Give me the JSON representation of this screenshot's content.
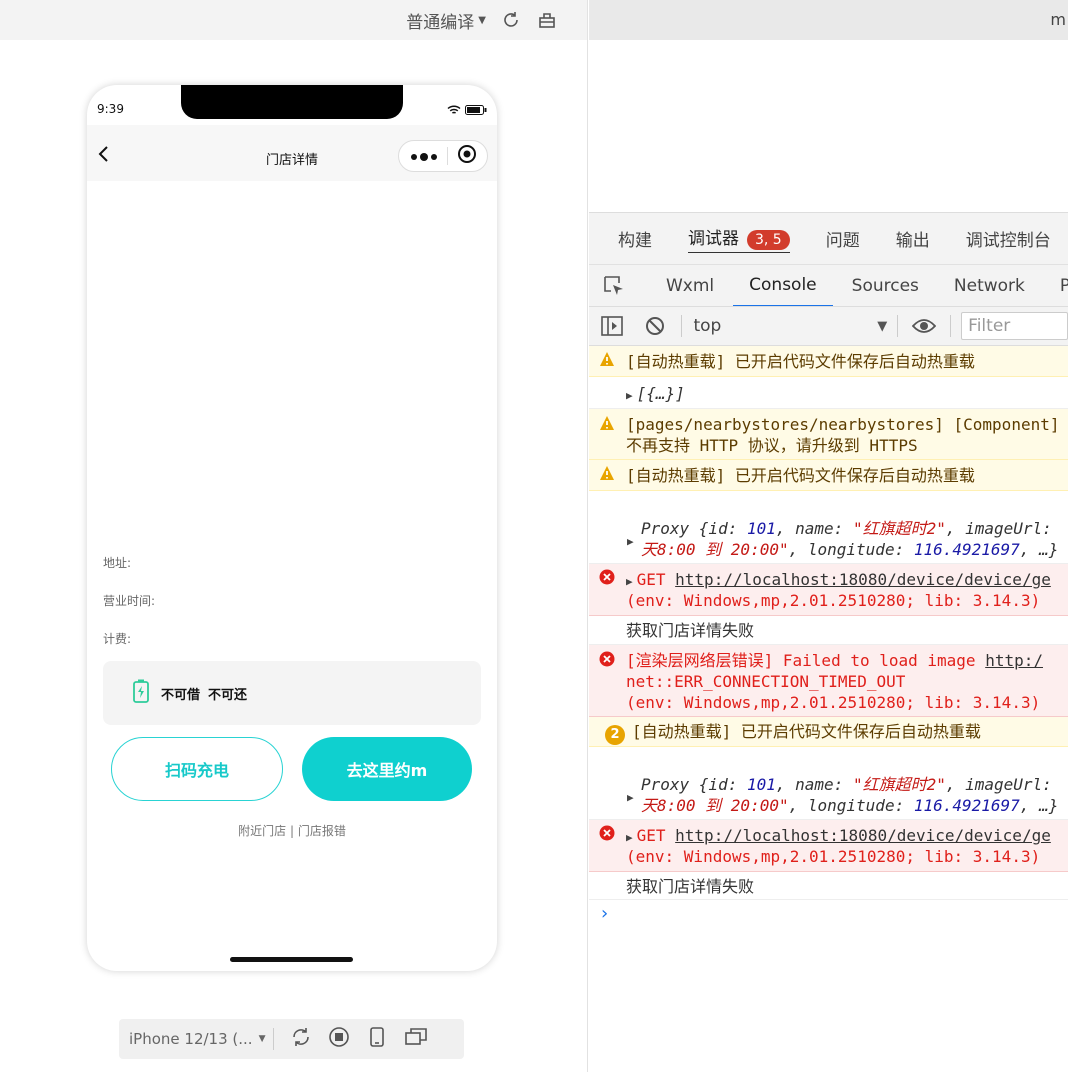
{
  "simulator": {
    "compile_mode": "普通编译",
    "status_time": "9:39",
    "nav_title": "门店详情",
    "labels": {
      "address": "地址:",
      "hours": "营业时间:",
      "billing": "计费:"
    },
    "status_text1": "不可借",
    "status_text2": "不可还",
    "scan_button": "扫码充电",
    "go_button": "去这里约m",
    "footer_links": "附近门店 | 门店报错",
    "device_name": "iPhone 12/13 (..."
  },
  "devtools": {
    "window_title_fragment": "m",
    "top_tabs": [
      {
        "label": "构建"
      },
      {
        "label": "调试器",
        "badge": "3, 5"
      },
      {
        "label": "问题"
      },
      {
        "label": "输出"
      },
      {
        "label": "调试控制台"
      }
    ],
    "panel_tabs": [
      "Wxml",
      "Console",
      "Sources",
      "Network",
      "Pe"
    ],
    "context": "top",
    "filter_placeholder": "Filter",
    "logs": {
      "l1": "[自动热重载] 已开启代码文件保存后自动热重载",
      "l2": "[{…}]",
      "l3a": "[pages/nearbystores/nearbystores] [Component]",
      "l3b": "不再支持 HTTP 协议，请升级到 HTTPS",
      "l4": "[自动热重载] 已开启代码文件保存后自动热重载",
      "l5a_pre": "Proxy {id: ",
      "l5a_id": "101",
      "l5a_mid": ", name: ",
      "l5a_name": "\"红旗超时2\"",
      "l5a_post": ", imageUrl:",
      "l5b_str": "天8:00 到 20:00\"",
      "l5b_mid": ", longitude: ",
      "l5b_num": "116.4921697",
      "l5b_post": ", …}",
      "l6a_get": "GET ",
      "l6a_url": "http://localhost:18080/device/device/ge",
      "l6b": "(env: Windows,mp,2.01.2510280; lib: 3.14.3)",
      "l7": "获取门店详情失败",
      "l8a_pre": "[渲染层网络层错误] Failed to load image ",
      "l8a_url": "http:/",
      "l8b": "net::ERR_CONNECTION_TIMED_OUT",
      "l8c": "(env: Windows,mp,2.01.2510280; lib: 3.14.3)",
      "l9_count": "2",
      "l9": "[自动热重载] 已开启代码文件保存后自动热重载",
      "l10a_pre": "Proxy {id: ",
      "l10a_id": "101",
      "l10a_mid": ", name: ",
      "l10a_name": "\"红旗超时2\"",
      "l10a_post": ", imageUrl:",
      "l10b_str": "天8:00 到 20:00\"",
      "l10b_mid": ", longitude: ",
      "l10b_num": "116.4921697",
      "l10b_post": ", …}",
      "l11a_get": "GET ",
      "l11a_url": "http://localhost:18080/device/device/ge",
      "l11b": "(env: Windows,mp,2.01.2510280; lib: 3.14.3)",
      "l12": "获取门店详情失败"
    }
  },
  "colors": {
    "accent": "#0fd0cf",
    "error": "#e0201b",
    "warning": "#e8a400",
    "badge": "#d23c2c",
    "link_blue": "#1a73e8"
  }
}
